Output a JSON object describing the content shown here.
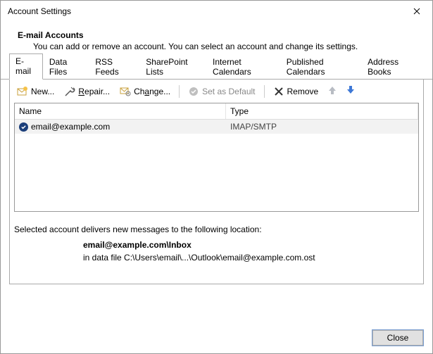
{
  "window": {
    "title": "Account Settings"
  },
  "header": {
    "title": "E-mail Accounts",
    "subtitle": "You can add or remove an account. You can select an account and change its settings."
  },
  "tabs": [
    {
      "label": "E-mail"
    },
    {
      "label": "Data Files"
    },
    {
      "label": "RSS Feeds"
    },
    {
      "label": "SharePoint Lists"
    },
    {
      "label": "Internet Calendars"
    },
    {
      "label": "Published Calendars"
    },
    {
      "label": "Address Books"
    }
  ],
  "toolbar": {
    "new": "New...",
    "repair": "Repair...",
    "change": "Change...",
    "set_default": "Set as Default",
    "remove": "Remove"
  },
  "columns": {
    "name": "Name",
    "type": "Type"
  },
  "accounts": [
    {
      "name": "email@example.com",
      "type": "IMAP/SMTP"
    }
  ],
  "location": {
    "intro": "Selected account delivers new messages to the following location:",
    "path_bold": "email@example.com\\Inbox",
    "path_detail": "in data file C:\\Users\\email\\...\\Outlook\\email@example.com.ost"
  },
  "footer": {
    "close": "Close"
  }
}
